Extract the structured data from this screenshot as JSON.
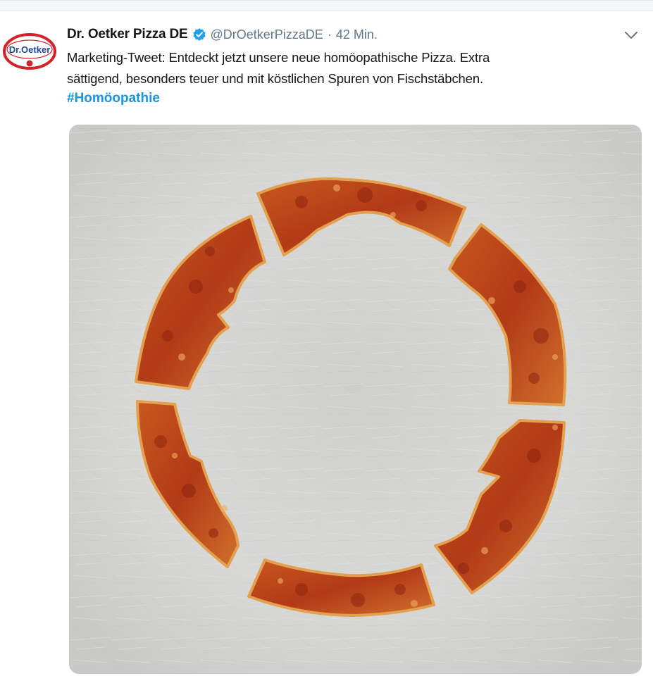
{
  "tweet": {
    "avatar_text": "Dr.Oetker",
    "display_name": "Dr. Oetker Pizza DE",
    "handle": "@DrOetkerPizzaDE",
    "separator": "·",
    "time": "42 Min.",
    "text_line1": "Marketing-Tweet: Entdeckt jetzt unsere neue homöopathische Pizza. Extra",
    "text_line2": "sättigend, besonders teuer und mit köstlichen Spuren von Fischstäbchen.",
    "hashtag": "#Homöopathie"
  },
  "icons": {
    "verified": "verified-badge-icon",
    "menu": "chevron-down-icon"
  },
  "colors": {
    "link": "#1b95e0",
    "brand_red": "#d2232a",
    "verified_blue": "#1da1f2"
  }
}
